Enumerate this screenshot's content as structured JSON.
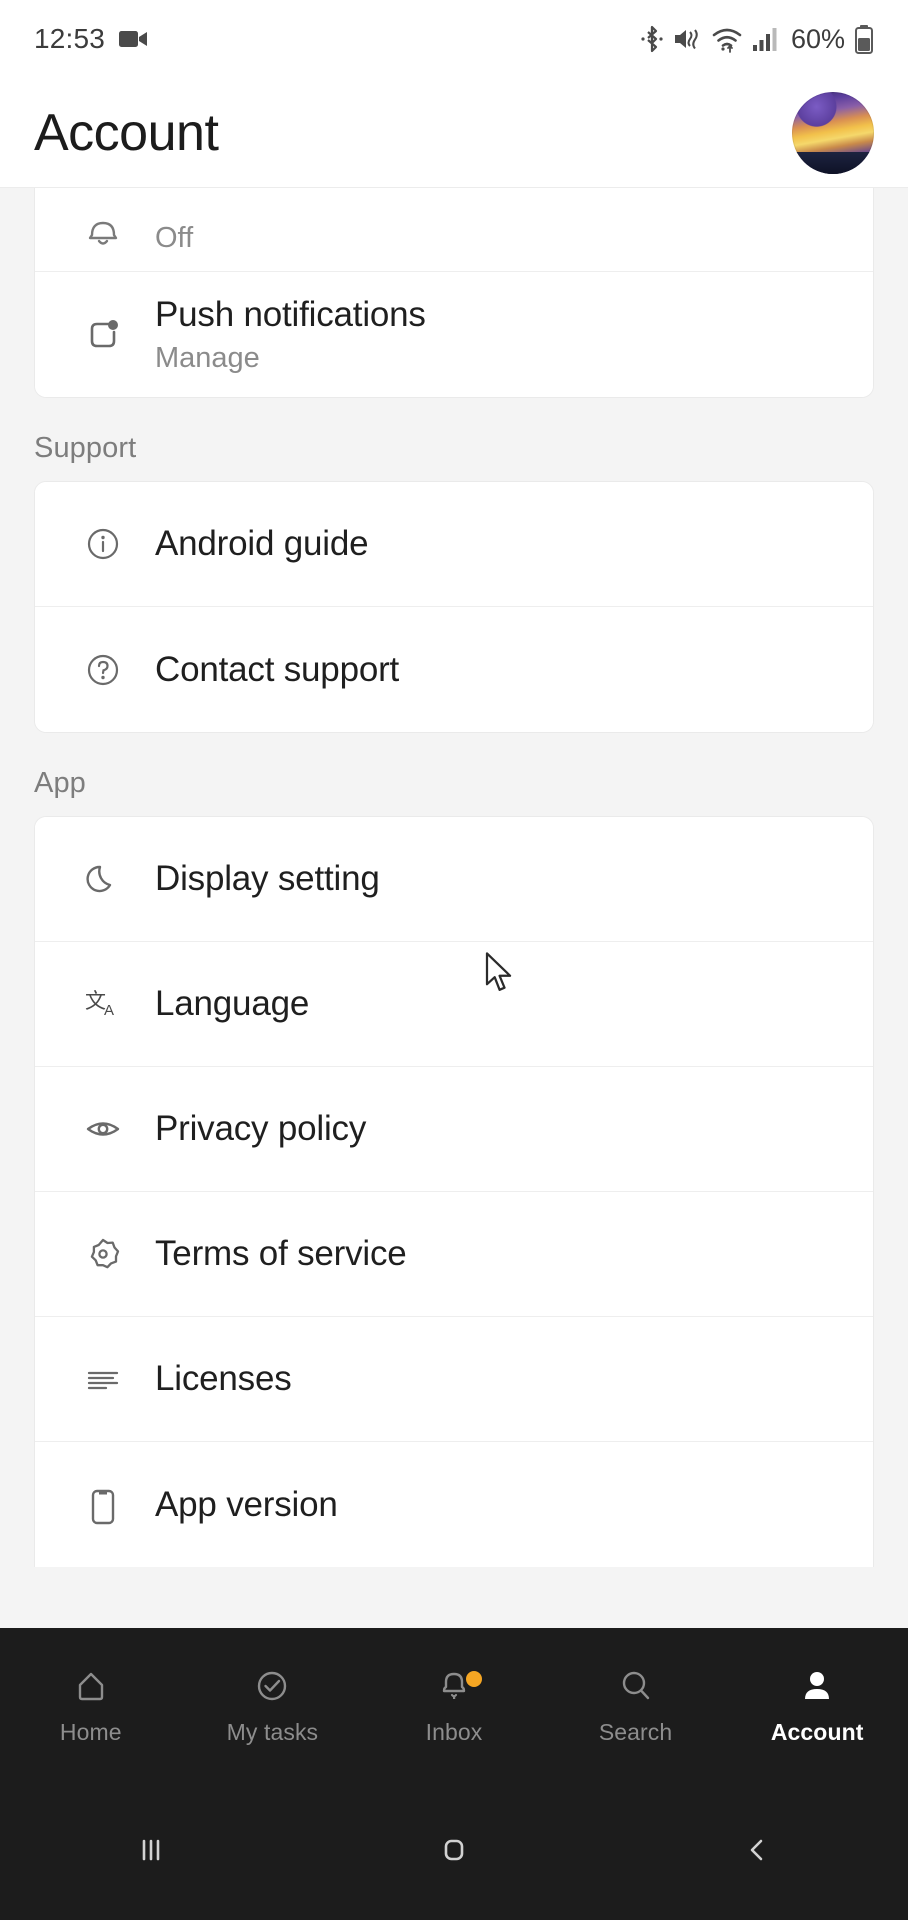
{
  "status_bar": {
    "time": "12:53",
    "battery_percent": "60%",
    "icons": [
      "video-recording-icon",
      "bluetooth-icon",
      "mute-vibrate-icon",
      "wifi-icon",
      "cellular-signal-icon",
      "battery-icon"
    ]
  },
  "header": {
    "title": "Account",
    "avatar": "user-avatar"
  },
  "sections": [
    {
      "label": "",
      "partial_top": true,
      "items": [
        {
          "icon": "bell-icon",
          "title": "",
          "subtitle": "Off"
        },
        {
          "icon": "push-notification-icon",
          "title": "Push notifications",
          "subtitle": "Manage"
        }
      ]
    },
    {
      "label": "Support",
      "items": [
        {
          "icon": "info-circle-icon",
          "title": "Android guide",
          "subtitle": ""
        },
        {
          "icon": "question-circle-icon",
          "title": "Contact support",
          "subtitle": ""
        }
      ]
    },
    {
      "label": "App",
      "items": [
        {
          "icon": "moon-icon",
          "title": "Display setting",
          "subtitle": ""
        },
        {
          "icon": "translate-icon",
          "title": "Language",
          "subtitle": ""
        },
        {
          "icon": "eye-icon",
          "title": "Privacy policy",
          "subtitle": ""
        },
        {
          "icon": "gear-icon",
          "title": "Terms of service",
          "subtitle": ""
        },
        {
          "icon": "text-lines-icon",
          "title": "Licenses",
          "subtitle": ""
        },
        {
          "icon": "phone-icon",
          "title": "App version",
          "subtitle": ""
        }
      ]
    }
  ],
  "bottom_nav": {
    "items": [
      {
        "label": "Home",
        "icon": "home-icon",
        "active": false,
        "badge": false
      },
      {
        "label": "My tasks",
        "icon": "check-circle-icon",
        "active": false,
        "badge": false
      },
      {
        "label": "Inbox",
        "icon": "bell-icon",
        "active": false,
        "badge": true
      },
      {
        "label": "Search",
        "icon": "search-icon",
        "active": false,
        "badge": false
      },
      {
        "label": "Account",
        "icon": "person-icon",
        "active": true,
        "badge": false
      }
    ],
    "active_color": "#ffffff",
    "inactive_color": "#8d8d8d",
    "badge_color": "#f5a623",
    "background": "#1c1c1c"
  },
  "system_nav": {
    "buttons": [
      "recents-icon",
      "home-square-icon",
      "back-chevron-icon"
    ]
  }
}
